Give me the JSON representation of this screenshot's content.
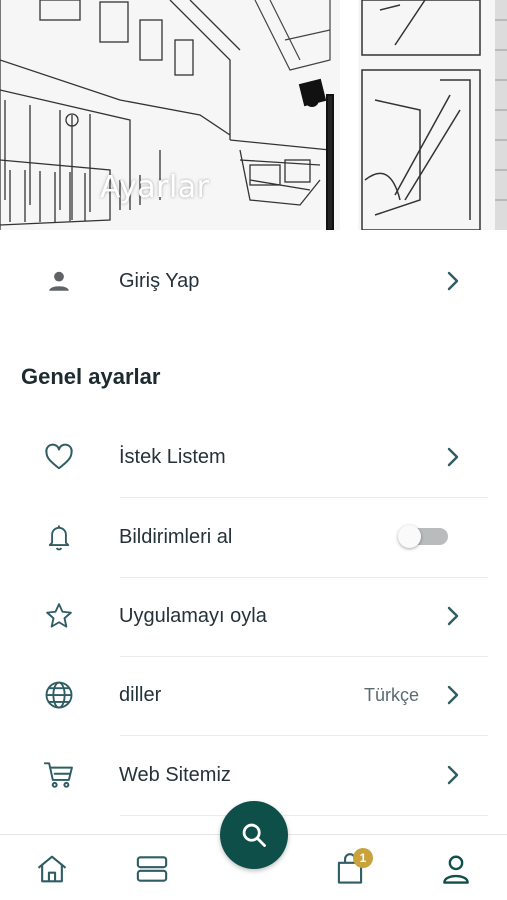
{
  "header": {
    "title": "Ayarlar"
  },
  "login": {
    "label": "Giriş Yap",
    "icon": "person-icon"
  },
  "general": {
    "title": "Genel ayarlar",
    "items": [
      {
        "label": "İstek Listem",
        "icon": "heart-icon",
        "control": "chevron"
      },
      {
        "label": "Bildirimleri al",
        "icon": "bell-icon",
        "control": "toggle",
        "toggle_on": false
      },
      {
        "label": "Uygulamayı oyla",
        "icon": "star-icon",
        "control": "chevron"
      },
      {
        "label": "diller",
        "icon": "globe-icon",
        "control": "chevron",
        "value": "Türkçe"
      },
      {
        "label": "Web Sitemiz",
        "icon": "cart-icon",
        "control": "chevron"
      }
    ]
  },
  "bottom_nav": {
    "items": [
      "home-icon",
      "categories-icon",
      "search-icon",
      "bag-icon",
      "profile-icon"
    ],
    "cart_badge": "1"
  },
  "colors": {
    "primary": "#0f4f4a",
    "icon": "#2f5d63",
    "badge": "#c9a23c"
  }
}
